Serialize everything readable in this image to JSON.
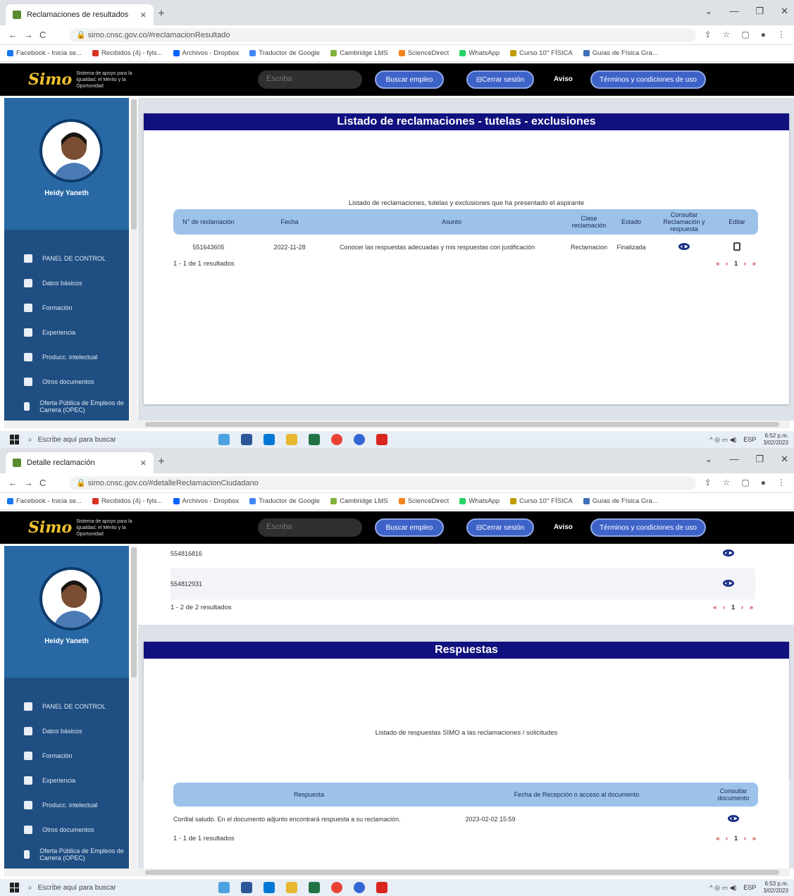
{
  "screen1": {
    "tab_title": "Reclamaciones de resultados",
    "url": "simo.cnsc.gov.co/#reclamacionResultado",
    "card_title": "Listado de reclamaciones - tutelas - exclusiones",
    "caption": "Listado de reclamaciones, tutelas y exclusiones que ha presentado el aspirante",
    "columns": [
      "N° de reclamación",
      "Fecha",
      "Asunto",
      "Clase reclamación",
      "Estado",
      "Consultar Reclamación y respuesta",
      "Editar"
    ],
    "row": {
      "id": "551643605",
      "date": "2022-11-28",
      "subject": "Conocer las respuestas adecuadas y mis respuestas con justificación",
      "class": "Reclamacion",
      "status": "Finalizada"
    },
    "count": "1 - 1 de 1 resultados"
  },
  "screen2": {
    "tab_title": "Detalle reclamación",
    "url": "simo.cnsc.gov.co/#detalleReclamacionCiudadano",
    "list_rows": [
      "554816816",
      "554812931"
    ],
    "list_count": "1 - 2 de 2 resultados",
    "card_title": "Respuestas",
    "caption": "Listado de respuestas SIMO a las reclamaciones / solicitudes",
    "columns": [
      "Respuesta",
      "Fecha de Recepción o acceso al documento",
      "Consultar documento"
    ],
    "row": {
      "response": "Cordial saludo. En el documento adjunto encontrará respuesta a su reclamación.",
      "date": "2023-02-02 15:59"
    },
    "count": "1 - 1 de 1 resultados"
  },
  "browser": {
    "bookmarks": [
      "Facebook - Inicia se...",
      "Recibidos (4) - fyls...",
      "Archivos - Dropbox",
      "Traductor de Google",
      "Cambridge LMS",
      "ScienceDirect",
      "WhatsApp",
      "Curso 10° FÍSICA",
      "Guías de Física Gra..."
    ]
  },
  "site": {
    "logo_mark": "Simo",
    "logo_tagline": "Sistema de apoyo para la Igualdad, el Mérito y la Oportunidad",
    "search_placeholder": "Escriba",
    "buscar_label": "Buscar empleo",
    "cerrar_label": "Cerrar sesión",
    "aviso_label": "Aviso",
    "terminos_label": "Términos y condiciones de uso",
    "user_name": "Heidy Yaneth",
    "menu": [
      "PANEL DE CONTROL",
      "Datos básicos",
      "Formación",
      "Experiencia",
      "Producc. intelectual",
      "Otros documentos",
      "Oferta Pública de Empleos de Carrera (OPEC)"
    ]
  },
  "taskbar": {
    "search_placeholder": "Escribe aquí para buscar",
    "lang": "ESP",
    "time1": "6:52 p.m.",
    "time2": "6:53 p.m.",
    "date": "3/02/2023"
  },
  "pager": {
    "first": "«",
    "prev": "‹",
    "page": "1",
    "next": "›",
    "last": "»"
  },
  "colors": {
    "title_bar": "#10107f",
    "table_header": "#9cc2ea",
    "sidebar": "#1f4e82",
    "pill": "#3e63c8",
    "pager": "#cc3333"
  }
}
